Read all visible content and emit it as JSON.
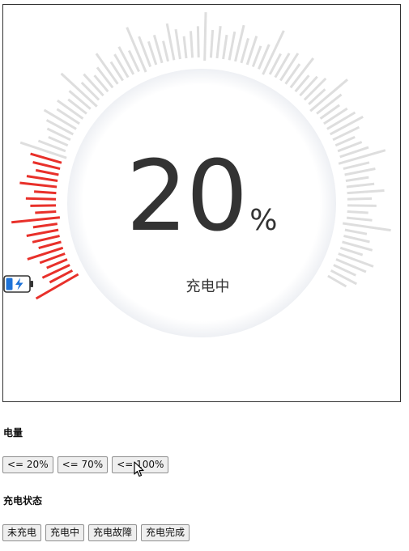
{
  "gauge": {
    "value": "20",
    "unit": "%",
    "level": 0.2,
    "status_text": "充电中",
    "active_color": "#e8302a",
    "inactive_color": "#dedede",
    "battery_color": "#1e73d8"
  },
  "level_section": {
    "title": "电量",
    "buttons": [
      "<= 20%",
      "<= 70%",
      "<= 100%"
    ]
  },
  "status_section": {
    "title": "充电状态",
    "buttons": [
      "未充电",
      "充电中",
      "充电故障",
      "充电完成"
    ]
  }
}
